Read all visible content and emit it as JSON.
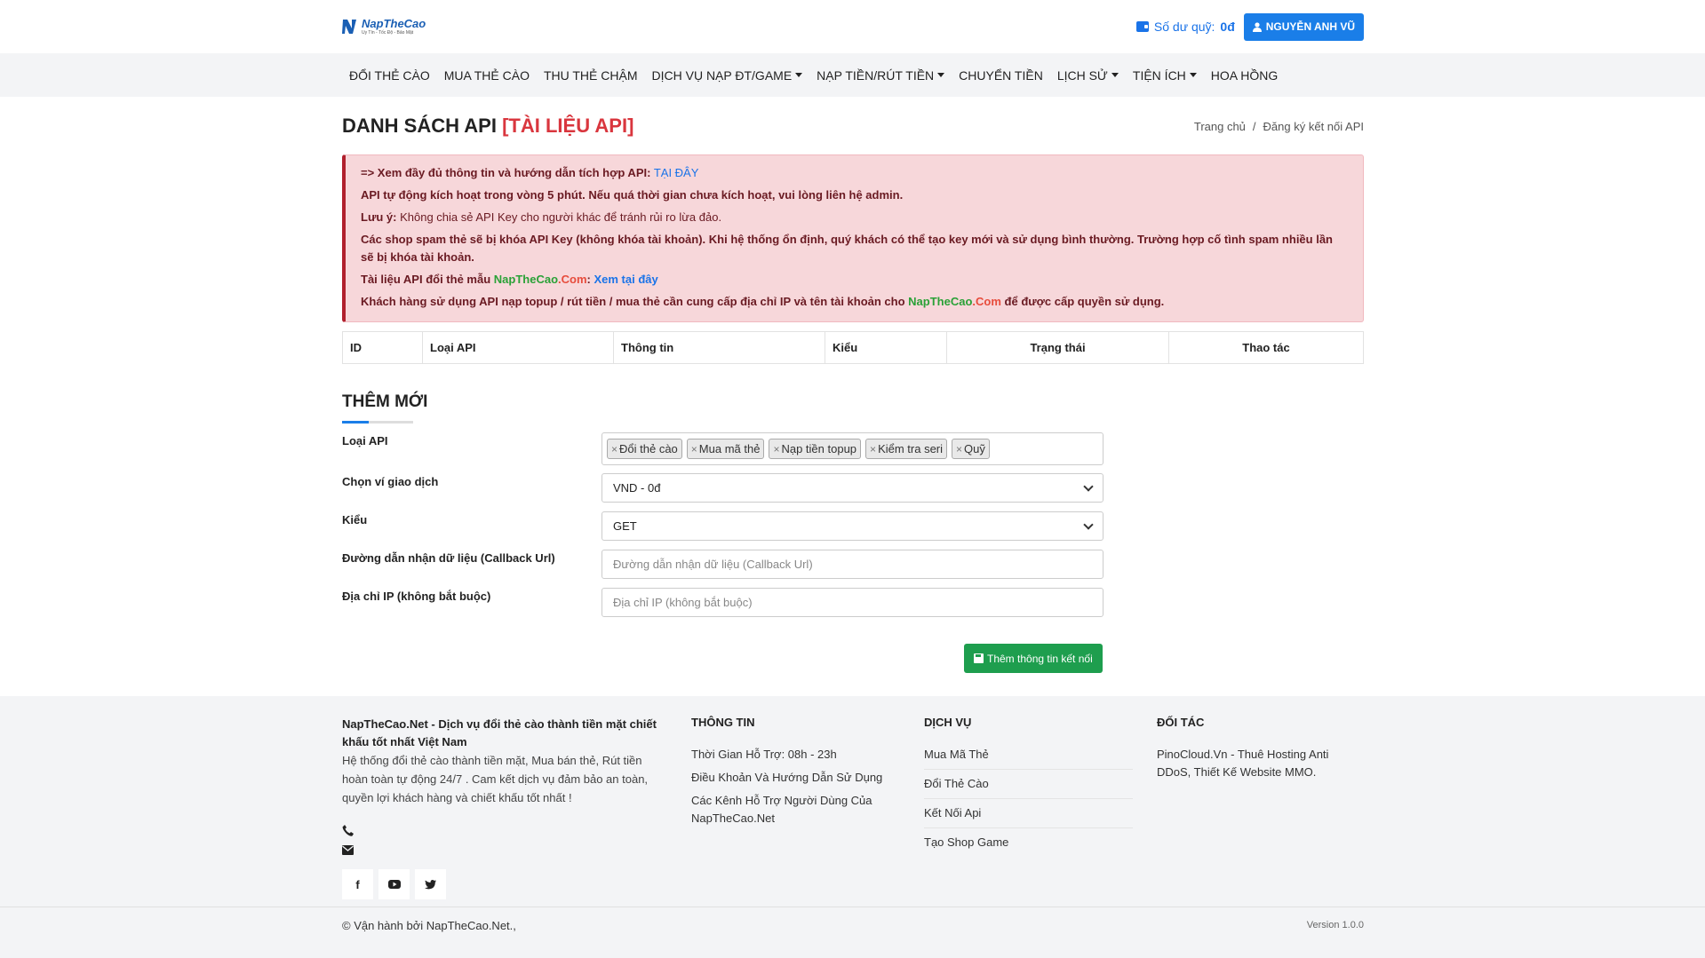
{
  "header": {
    "logo_name": "NapTheCao",
    "logo_tagline": "Uy Tín - Tốc Độ - Bảo Mật",
    "balance_label": "Số dư quỹ:",
    "balance_value": "0đ",
    "user_name": "NGUYỄN ANH VŨ"
  },
  "nav": {
    "items": [
      {
        "label": "ĐỔI THẺ CÀO",
        "dropdown": false
      },
      {
        "label": "MUA THẺ CÀO",
        "dropdown": false
      },
      {
        "label": "THU THẺ CHẬM",
        "dropdown": false
      },
      {
        "label": "DỊCH VỤ NẠP ĐT/GAME",
        "dropdown": true
      },
      {
        "label": "NẠP TIỀN/RÚT TIỀN",
        "dropdown": true
      },
      {
        "label": "CHUYỂN TIỀN",
        "dropdown": false
      },
      {
        "label": "LỊCH SỬ",
        "dropdown": true
      },
      {
        "label": "TIỆN ÍCH",
        "dropdown": true
      },
      {
        "label": "HOA HỒNG",
        "dropdown": false
      }
    ]
  },
  "page": {
    "title": "DANH SÁCH API",
    "title_link": "[TÀI LIỆU API]",
    "breadcrumb": [
      "Trang chủ",
      "/",
      "Đăng ký kết nối API"
    ]
  },
  "alert": {
    "line1_text": "=> Xem đầy đủ thông tin và hướng dẫn tích hợp API:",
    "line1_link": "TẠI ĐÂY",
    "line2": "API tự động kích hoạt trong vòng 5 phút. Nếu quá thời gian chưa kích hoạt, vui lòng liên hệ admin.",
    "line3_label": "Lưu ý:",
    "line3_text": "Không chia sẻ API Key cho người khác để tránh rủi ro lừa đảo.",
    "line4": "Các shop spam thẻ sẽ bị khóa API Key (không khóa tài khoản). Khi hệ thống ổn định, quý khách có thể tạo key mới và sử dụng bình thường. Trường hợp cố tình spam nhiều lần sẽ bị khóa tài khoản.",
    "line5_text": "Tài liệu API đổi thẻ mẫu",
    "line5_brand_a": "NapTheCao",
    "line5_brand_b": ".Com",
    "line5_colon": ":",
    "line5_link": "Xem tại đây",
    "line6_text": "Khách hàng sử dụng API nạp topup / rút tiền / mua thẻ cần cung cấp địa chỉ IP và tên tài khoản cho",
    "line6_brand_a": "NapTheCao",
    "line6_brand_b": ".Com",
    "line6_tail": "để được cấp quyền sử dụng."
  },
  "table": {
    "headers": [
      "ID",
      "Loại API",
      "Thông tin",
      "Kiểu",
      "Trạng thái",
      "Thao tác"
    ]
  },
  "form": {
    "section_title": "THÊM MỚI",
    "api_type_label": "Loại API",
    "api_tags": [
      "Đổi thẻ cào",
      "Mua mã thẻ",
      "Nạp tiền topup",
      "Kiểm tra seri",
      "Quỹ"
    ],
    "wallet_label": "Chọn ví giao dịch",
    "wallet_value": "VND - 0đ",
    "method_label": "Kiểu",
    "method_value": "GET",
    "callback_label": "Đường dẫn nhận dữ liệu (Callback Url)",
    "callback_placeholder": "Đường dẫn nhận dữ liệu (Callback Url)",
    "ip_label": "Địa chỉ IP (không bắt buộc)",
    "ip_placeholder": "Địa chỉ IP (không bắt buộc)",
    "submit_label": "Thêm thông tin kết nối"
  },
  "footer": {
    "about_title": "NapTheCao.Net - Dịch vụ đổi thẻ cào thành tiền mặt chiết khấu tốt nhất Việt Nam",
    "about_desc": "Hệ thống đổi thẻ cào thành tiền mặt, Mua bán thẻ, Rút tiền hoàn toàn tự động 24/7 . Cam kết dịch vụ đảm bảo an toàn, quyền lợi khách hàng và chiết khấu tốt nhất !",
    "info_title": "THÔNG TIN",
    "info_links": [
      "Thời Gian Hỗ Trợ: 08h - 23h",
      "Điều Khoản Và Hướng Dẫn Sử Dụng",
      "Các Kênh Hỗ Trợ Người Dùng Của NapTheCao.Net"
    ],
    "service_title": "DỊCH VỤ",
    "service_links": [
      "Mua Mã Thẻ",
      "Đổi Thẻ Cào",
      "Kết Nối Api",
      "Tạo Shop Game"
    ],
    "partner_title": "ĐỐI TÁC",
    "partner_text": "PinoCloud.Vn - Thuê Hosting Anti DDoS, Thiết Kế Website MMO.",
    "copyright": "© Vận hành bởi NapTheCao.Net.,",
    "version": "Version 1.0.0"
  },
  "colors": {
    "primary": "#1a7ee8",
    "danger_title": "#d9363e",
    "alert_bg": "#f7d7da",
    "success": "#1e9e4e"
  }
}
